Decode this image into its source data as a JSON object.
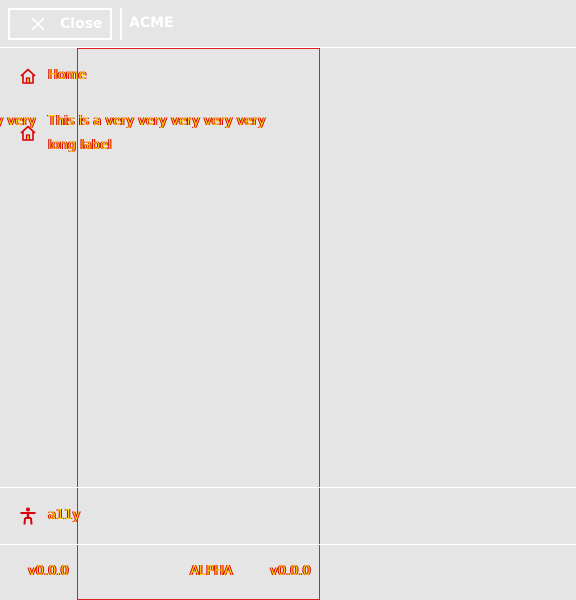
{
  "header": {
    "close_label": "Close",
    "brand": "ACME"
  },
  "nav": {
    "items": [
      {
        "label": "Home",
        "icon": "home-icon"
      },
      {
        "label": "This is a very very very very very long label",
        "overflow_fragment": "very very",
        "icon": "home-icon"
      }
    ]
  },
  "footer": {
    "a11y_label": "a11y",
    "version_left": "v0.0.0",
    "stage": "ALPHA",
    "version_right": "v0.0.0"
  },
  "colors": {
    "background": "#e5e5e5",
    "text_fill": "#ffd400",
    "text_outline": "#d8000c",
    "outline": "#e31b1b",
    "header_fg": "#ffffff"
  }
}
